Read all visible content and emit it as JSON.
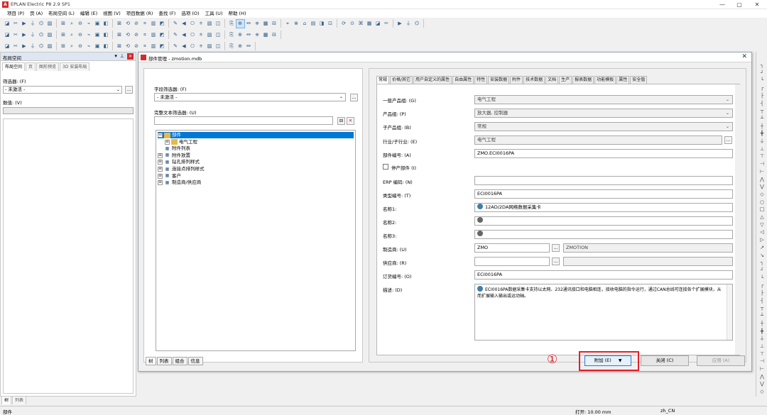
{
  "app": {
    "title": "EPLAN Electric P8 2.9 SP1",
    "logo": "A",
    "window_controls": [
      "—",
      "▢",
      "✕"
    ]
  },
  "menu": [
    "项目 (P)",
    "页 (A)",
    "布局空间 (L)",
    "编辑 (E)",
    "视图 (V)",
    "项目数据 (R)",
    "查找 (F)",
    "选项 (O)",
    "工具 (U)",
    "帮助 (H)"
  ],
  "toolbars": {
    "row1_icons": [
      "new-icon",
      "open-icon",
      "save-icon",
      "print-icon",
      "key-icon",
      "cut-icon",
      "copy-icon",
      "paste-icon",
      "wire-icon",
      "pen-icon",
      "check-icon",
      "undo-icon",
      "redo-icon",
      "undo2-icon",
      "redo2-icon",
      "page-icon",
      "list-icon",
      "refresh-icon",
      "zoom-in-icon",
      "zoom-out-icon",
      "zoom-window-icon",
      "zoom-fit-icon",
      "arrow-left-icon",
      "arrow-right-icon",
      "grid-icon",
      "snap-icon",
      "ortho-icon",
      "tb-a-icon",
      "tb-b-icon",
      "tb-c-icon",
      "tb-d-icon",
      "tb-e-icon",
      "tb-f-icon",
      "tb-g-icon",
      "tb-h-icon",
      "tb-i-icon",
      "tb-j-icon",
      "tb-k-icon",
      "tb-l-icon",
      "tb-m-icon",
      "tb-n-icon",
      "tb-o-icon",
      "tb-p-icon",
      "tb-q-icon",
      "tb-r-icon"
    ],
    "row2_icons": [
      "nav-icon",
      "layout-icon",
      "tree-icon",
      "device-icon",
      "terminal-icon",
      "plug-icon",
      "cable-icon",
      "pin-icon",
      "symbol-icon",
      "macro-icon",
      "report-icon",
      "graph-icon",
      "translate-icon",
      "dict-icon",
      "plc-icon",
      "bus-icon",
      "fluid-icon",
      "pipe-icon",
      "valve-icon",
      "pump-icon",
      "tank-icon",
      "motor-icon",
      "switch-icon",
      "coil-icon",
      "contact-icon",
      "fuse-icon",
      "breaker-icon",
      "lamp-icon",
      "sensor-icon",
      "relay-icon"
    ],
    "row3_icons": [
      "line-icon",
      "rect-icon",
      "circle-icon",
      "arc-icon",
      "poly-icon",
      "text-icon",
      "dim-icon",
      "hatch-icon",
      "image-icon",
      "ohm-icon",
      "minus-icon",
      "dash-icon",
      "conn-a-icon",
      "conn-b-icon",
      "conn-c-icon",
      "conn-d-icon",
      "conn-e-icon",
      "conn-f-icon",
      "conn-g-icon",
      "conn-h-icon",
      "conn-i-icon",
      "conn-j-icon",
      "conn-k-icon",
      "conn-l-icon",
      "conn-m-icon",
      "conn-n-icon",
      "conn-o-icon"
    ]
  },
  "left_panel": {
    "title": "布局空间",
    "controls": [
      "▾",
      "⊥"
    ],
    "close": "✕",
    "tabs": [
      "布局空间",
      "页",
      "图形预览",
      "3D 安装布局"
    ],
    "filter_label": "筛选器: (F)",
    "filter_value": "- 未激活 -",
    "filter_btn": "...",
    "value_label": "数值: (V)",
    "bottom_tabs": [
      "树",
      "列表"
    ]
  },
  "dialog": {
    "title": "部件管理 - zmotion.mdb",
    "close": "✕",
    "field_filter_label": "字段筛选器: (F)",
    "field_filter_value": "- 未激活 -",
    "field_filter_btn": "...",
    "fulltext_label": "完整文本筛选器: (U)",
    "fulltext_value": "",
    "tree": [
      {
        "label": "部件",
        "expander": "⊟",
        "icon": "folder-icon",
        "selected": true,
        "level": 0
      },
      {
        "label": "电气工程",
        "expander": "⊞",
        "icon": "folder-icon",
        "selected": false,
        "level": 1
      },
      {
        "label": "附件列表",
        "expander": "",
        "icon": "list-icon",
        "selected": false,
        "level": 0
      },
      {
        "label": "附件放置",
        "expander": "⊞",
        "icon": "place-icon",
        "selected": false,
        "level": 0
      },
      {
        "label": "钻孔排列样式",
        "expander": "⊞",
        "icon": "drill-icon",
        "selected": false,
        "level": 0
      },
      {
        "label": "连接点排列样式",
        "expander": "⊞",
        "icon": "connpt-icon",
        "selected": false,
        "level": 0
      },
      {
        "label": "客户",
        "expander": "⊞",
        "icon": "customer-icon",
        "selected": false,
        "level": 0
      },
      {
        "label": "制造商/供应商",
        "expander": "⊞",
        "icon": "manufacturer-icon",
        "selected": false,
        "level": 0
      }
    ],
    "tree_tabs": [
      "树",
      "列表",
      "组合",
      "信息"
    ],
    "prop_tabs": [
      "常规",
      "价格/其它",
      "用户自定义的属性",
      "自由属性",
      "特性",
      "安装数据",
      "附件",
      "技术数据",
      "文档",
      "生产",
      "报表数据",
      "功能模板",
      "属性",
      "安全值"
    ],
    "fields": {
      "generic_group_label": "一般产品组: (G)",
      "generic_group": "电气工程",
      "product_group_label": "产品组: (P)",
      "product_group": "放大器, 控制器",
      "subgroup_label": "子产品组: (B)",
      "subgroup": "常规",
      "industry_label": "行业/子行业: (E)",
      "industry": "电气工程",
      "part_number_label": "部件编号: (A)",
      "part_number": "ZMO.ECI0016PA",
      "discontinued_label": "停产部件 (I)",
      "erp_label": "ERP 编码: (N)",
      "erp": "",
      "type_number_label": "类型编号: (T)",
      "type_number": "ECI0016PA",
      "name1_label": "名称1:",
      "name1": "12AD/2DA网络数据采集卡",
      "name2_label": "名称2:",
      "name2": "",
      "name3_label": "名称3:",
      "name3": "",
      "manufacturer_label": "制造商: (U)",
      "manufacturer_code": "ZMO",
      "manufacturer_name": "ZMOTION",
      "supplier_label": "供应商: (R)",
      "supplier_code": "",
      "supplier_name": "",
      "order_number_label": "订货编号: (O)",
      "order_number": "ECI0016PA",
      "description_label": "描述: (D)",
      "description": "ECI0016PA数据采集卡支持以太网、232通讯接口和电脑相连，接收电脑的指令运行，通过CAN总线可连接各个扩展模块，从而扩展输入输出或运动轴。",
      "dots": "..."
    },
    "buttons": {
      "attach": "附加 (E)",
      "attach_arrow": "▼",
      "close": "关闭 (C)",
      "apply": "应用 (A)"
    },
    "annotation_number": "①"
  },
  "status": {
    "left": "部件",
    "grid": "打开: 10.00 mm",
    "locale": "zh_CN"
  },
  "colors": {
    "accent": "#0078d7",
    "highlight": "#e0202a",
    "logo": "#d42a2a"
  }
}
